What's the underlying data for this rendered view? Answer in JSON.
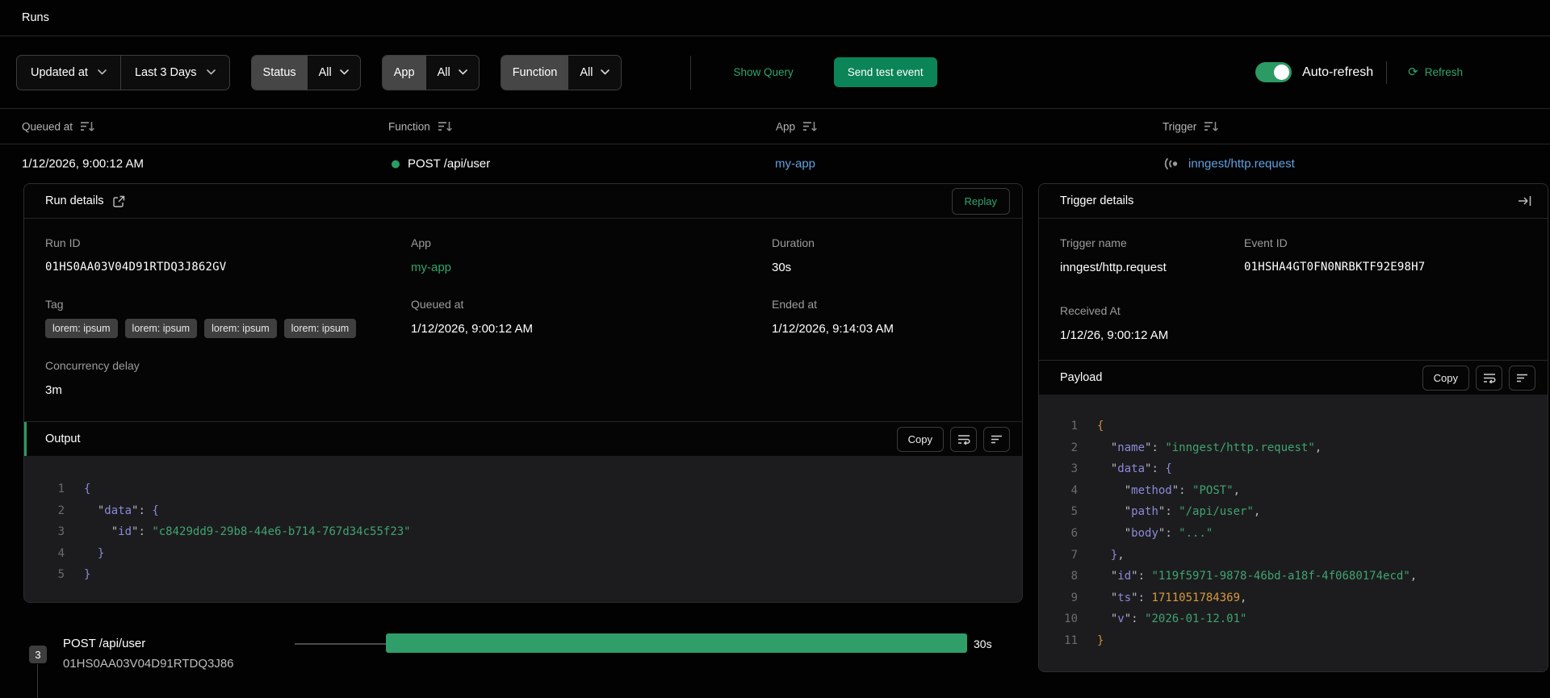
{
  "header": {
    "title": "Runs"
  },
  "filters": {
    "sort_by": {
      "label": "Updated at"
    },
    "range": {
      "label": "Last 3 Days"
    },
    "status": {
      "label": "Status",
      "value": "All"
    },
    "app": {
      "label": "App",
      "value": "All"
    },
    "function": {
      "label": "Function",
      "value": "All"
    },
    "show_query": "Show Query",
    "send_test_event": "Send test event",
    "auto_refresh": {
      "label": "Auto-refresh",
      "enabled": true
    },
    "refresh": "Refresh"
  },
  "table": {
    "columns": [
      {
        "label": "Queued at"
      },
      {
        "label": "Function"
      },
      {
        "label": "App"
      },
      {
        "label": "Trigger"
      }
    ],
    "row": {
      "queued_at": "1/12/2026, 9:00:12 AM",
      "function": "POST /api/user",
      "status_color": "#2c9b63",
      "app": "my-app",
      "trigger": "inngest/http.request"
    }
  },
  "run_details": {
    "title": "Run details",
    "replay_label": "Replay",
    "fields": {
      "run_id": {
        "label": "Run ID",
        "value": "01HS0AA03V04D91RTDQ3J862GV"
      },
      "app": {
        "label": "App",
        "value": "my-app"
      },
      "duration": {
        "label": "Duration",
        "value": "30s"
      },
      "tag": {
        "label": "Tag",
        "values": [
          "lorem: ipsum",
          "lorem: ipsum",
          "lorem: ipsum",
          "lorem: ipsum"
        ]
      },
      "queued_at": {
        "label": "Queued at",
        "value": "1/12/2026, 9:00:12 AM"
      },
      "ended_at": {
        "label": "Ended at",
        "value": "1/12/2026, 9:14:03 AM"
      },
      "concurrency_delay": {
        "label": "Concurrency delay",
        "value": "3m"
      }
    },
    "output": {
      "title": "Output",
      "copy_label": "Copy",
      "code": [
        {
          "n": "1",
          "t": [
            [
              "{",
              "b1"
            ]
          ]
        },
        {
          "n": "2",
          "t": [
            [
              "  ",
              "pl"
            ],
            [
              "\"",
              "pun"
            ],
            [
              "data",
              "key"
            ],
            [
              "\"",
              "pun"
            ],
            [
              ": ",
              "pun"
            ],
            [
              "{",
              "b1"
            ]
          ]
        },
        {
          "n": "3",
          "t": [
            [
              "    ",
              "pl"
            ],
            [
              "\"",
              "pun"
            ],
            [
              "id",
              "key"
            ],
            [
              "\"",
              "pun"
            ],
            [
              ": ",
              "pun"
            ],
            [
              "\"c8429dd9-29b8-44e6-b714-767d34c55f23\"",
              "str"
            ]
          ]
        },
        {
          "n": "4",
          "t": [
            [
              "  ",
              "pl"
            ],
            [
              "}",
              "b1"
            ]
          ]
        },
        {
          "n": "5",
          "t": [
            [
              "}",
              "b1"
            ]
          ]
        }
      ]
    }
  },
  "trigger_details": {
    "title": "Trigger details",
    "fields": {
      "trigger_name": {
        "label": "Trigger name",
        "value": "inngest/http.request"
      },
      "event_id": {
        "label": "Event ID",
        "value": "01HSHA4GT0FN0NRBKTF92E98H7"
      },
      "received_at": {
        "label": "Received At",
        "value": "1/12/26, 9:00:12 AM"
      }
    },
    "payload": {
      "title": "Payload",
      "copy_label": "Copy",
      "code": [
        {
          "n": "1",
          "t": [
            [
              "{",
              "b0"
            ]
          ]
        },
        {
          "n": "2",
          "t": [
            [
              "  ",
              "pl"
            ],
            [
              "\"",
              "pun"
            ],
            [
              "name",
              "key"
            ],
            [
              "\"",
              "pun"
            ],
            [
              ": ",
              "pun"
            ],
            [
              "\"inngest/http.request\"",
              "str"
            ],
            [
              ",",
              "pun"
            ]
          ]
        },
        {
          "n": "3",
          "t": [
            [
              "  ",
              "pl"
            ],
            [
              "\"",
              "pun"
            ],
            [
              "data",
              "key"
            ],
            [
              "\"",
              "pun"
            ],
            [
              ": ",
              "pun"
            ],
            [
              "{",
              "b1"
            ]
          ]
        },
        {
          "n": "4",
          "t": [
            [
              "    ",
              "pl"
            ],
            [
              "\"",
              "pun"
            ],
            [
              "method",
              "key"
            ],
            [
              "\"",
              "pun"
            ],
            [
              ": ",
              "pun"
            ],
            [
              "\"POST\"",
              "str"
            ],
            [
              ",",
              "pun"
            ]
          ]
        },
        {
          "n": "5",
          "t": [
            [
              "    ",
              "pl"
            ],
            [
              "\"",
              "pun"
            ],
            [
              "path",
              "key"
            ],
            [
              "\"",
              "pun"
            ],
            [
              ": ",
              "pun"
            ],
            [
              "\"/api/user\"",
              "str"
            ],
            [
              ",",
              "pun"
            ]
          ]
        },
        {
          "n": "6",
          "t": [
            [
              "    ",
              "pl"
            ],
            [
              "\"",
              "pun"
            ],
            [
              "body",
              "key"
            ],
            [
              "\"",
              "pun"
            ],
            [
              ": ",
              "pun"
            ],
            [
              "\"...\"",
              "str"
            ]
          ]
        },
        {
          "n": "7",
          "t": [
            [
              "  ",
              "pl"
            ],
            [
              "}",
              "b1"
            ],
            [
              ",",
              "pun"
            ]
          ]
        },
        {
          "n": "8",
          "t": [
            [
              "  ",
              "pl"
            ],
            [
              "\"",
              "pun"
            ],
            [
              "id",
              "key"
            ],
            [
              "\"",
              "pun"
            ],
            [
              ": ",
              "pun"
            ],
            [
              "\"119f5971-9878-46bd-a18f-4f0680174ecd\"",
              "str"
            ],
            [
              ",",
              "pun"
            ]
          ]
        },
        {
          "n": "9",
          "t": [
            [
              "  ",
              "pl"
            ],
            [
              "\"",
              "pun"
            ],
            [
              "ts",
              "key"
            ],
            [
              "\"",
              "pun"
            ],
            [
              ": ",
              "pun"
            ],
            [
              "1711051784369",
              "num"
            ],
            [
              ",",
              "pun"
            ]
          ]
        },
        {
          "n": "10",
          "t": [
            [
              "  ",
              "pl"
            ],
            [
              "\"",
              "pun"
            ],
            [
              "v",
              "key"
            ],
            [
              "\"",
              "pun"
            ],
            [
              ": ",
              "pun"
            ],
            [
              "\"2026-01-12.01\"",
              "str"
            ]
          ]
        },
        {
          "n": "11",
          "t": [
            [
              "}",
              "b0"
            ]
          ]
        }
      ]
    }
  },
  "timeline": {
    "step_count": "3",
    "step_name": "POST /api/user",
    "step_id": "01HS0AA03V04D91RTDQ3J86",
    "duration": "30s",
    "bar_color": "#2f9e68"
  },
  "colors": {
    "accent_green": "#2c9b63",
    "link_blue": "#61a1e0",
    "button_green": "#0b8457"
  }
}
